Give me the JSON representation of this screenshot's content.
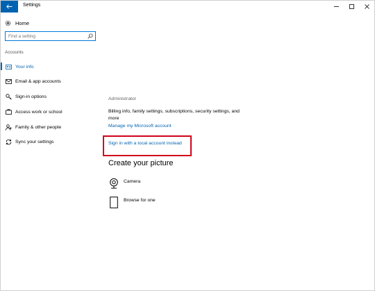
{
  "window": {
    "title": "Settings"
  },
  "sidebar": {
    "home_label": "Home",
    "search": {
      "placeholder": "Find a setting",
      "value": ""
    },
    "section_label": "Accounts",
    "items": [
      {
        "label": "Your info",
        "icon": "person-card-icon",
        "active": true
      },
      {
        "label": "Email & app accounts",
        "icon": "mail-icon",
        "active": false
      },
      {
        "label": "Sign-in options",
        "icon": "key-icon",
        "active": false
      },
      {
        "label": "Access work or school",
        "icon": "briefcase-icon",
        "active": false
      },
      {
        "label": "Family & other people",
        "icon": "add-person-icon",
        "active": false
      },
      {
        "label": "Sync your settings",
        "icon": "sync-icon",
        "active": false
      }
    ]
  },
  "main": {
    "account_role": "Administrator",
    "billing_text": "Billing info, family settings, subscriptions, security settings, and more",
    "manage_link": "Manage my Microsoft account",
    "local_account_link": "Sign in with a local account instead",
    "picture_heading": "Create your picture",
    "picture_options": [
      {
        "label": "Camera",
        "icon": "camera-icon"
      },
      {
        "label": "Browse for one",
        "icon": "browse-file-icon"
      }
    ]
  },
  "colors": {
    "accent": "#0063b1",
    "highlight_border": "#d0021b"
  }
}
